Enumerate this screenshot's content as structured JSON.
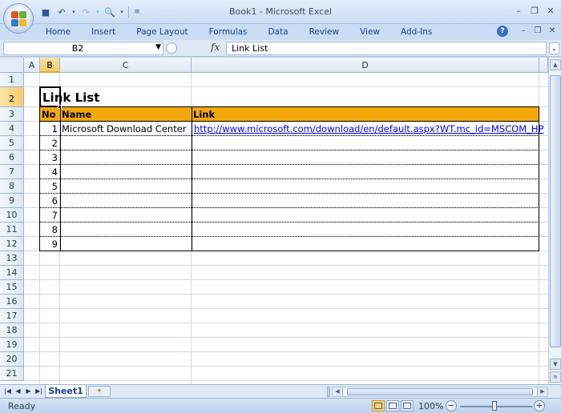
{
  "window": {
    "title": "Book1 - Microsoft Excel"
  },
  "quick_access": {
    "save_icon": "save-icon",
    "undo_icon": "undo-icon",
    "redo_icon": "redo-icon",
    "print_preview_icon": "print-preview-icon"
  },
  "ribbon": {
    "tabs": [
      "Home",
      "Insert",
      "Page Layout",
      "Formulas",
      "Data",
      "Review",
      "View",
      "Add-Ins"
    ]
  },
  "formula_bar": {
    "name_box": "B2",
    "fx": "fx",
    "content": "Link List"
  },
  "columns": [
    "A",
    "B",
    "C",
    "D"
  ],
  "selected_column": "B",
  "rows": [
    "1",
    "2",
    "3",
    "4",
    "5",
    "6",
    "7",
    "8",
    "9",
    "10",
    "11",
    "12",
    "13",
    "14",
    "15",
    "16",
    "17",
    "18",
    "19",
    "20",
    "21"
  ],
  "selected_row": "2",
  "sheet": {
    "title": "Link List",
    "headers": {
      "no": "No",
      "name": "Name",
      "link": "Link"
    },
    "records": [
      {
        "no": "1",
        "name": "Microsoft Download Center",
        "link": "http://www.microsoft.com/download/en/default.aspx?WT.mc_id=MSCOM_HP"
      },
      {
        "no": "2",
        "name": "",
        "link": ""
      },
      {
        "no": "3",
        "name": "",
        "link": ""
      },
      {
        "no": "4",
        "name": "",
        "link": ""
      },
      {
        "no": "5",
        "name": "",
        "link": ""
      },
      {
        "no": "6",
        "name": "",
        "link": ""
      },
      {
        "no": "7",
        "name": "",
        "link": ""
      },
      {
        "no": "8",
        "name": "",
        "link": ""
      },
      {
        "no": "9",
        "name": "",
        "link": ""
      }
    ],
    "header_color": "#f3a80c"
  },
  "sheet_tabs": {
    "active": "Sheet1"
  },
  "status": {
    "text": "Ready",
    "zoom": "100%",
    "minus": "−",
    "plus": "+"
  }
}
